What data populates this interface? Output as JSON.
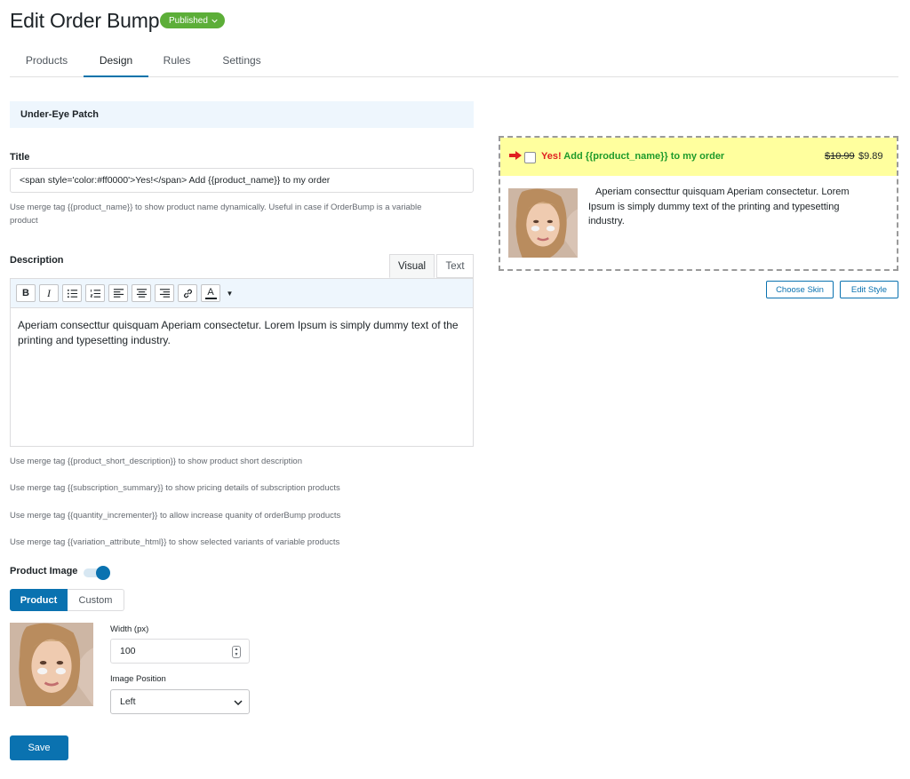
{
  "header": {
    "title": "Edit Order Bump",
    "status": "Published"
  },
  "tabs": [
    {
      "label": "Products"
    },
    {
      "label": "Design"
    },
    {
      "label": "Rules"
    },
    {
      "label": "Settings"
    }
  ],
  "product": {
    "name": "Under-Eye Patch"
  },
  "title_field": {
    "label": "Title",
    "value": "<span style='color:#ff0000'>Yes!</span> Add {{product_name}} to my order",
    "help_line1": "Use merge tag {{product_name}} to show product name dynamically. Useful in case if OrderBump is a variable",
    "help_line2": "product"
  },
  "description": {
    "label": "Description",
    "tab_visual": "Visual",
    "tab_text": "Text",
    "bold": "B",
    "italic": "I",
    "text_color": "A",
    "content": "Aperiam consecttur quisquam Aperiam consectetur. Lorem Ipsum is simply dummy text of the printing and typesetting industry.",
    "help": [
      "Use merge tag {{product_short_description}} to show product short description",
      "Use merge tag {{subscription_summary}} to show pricing details of subscription products",
      "Use merge tag {{quantity_incrementer}} to allow increase quanity of orderBump products",
      "Use merge tag {{variation_attribute_html}} to show selected variants of variable products"
    ]
  },
  "product_image": {
    "label": "Product Image",
    "enabled": true,
    "source_product": "Product",
    "source_custom": "Custom",
    "width_label": "Width (px)",
    "width_value": "100",
    "position_label": "Image Position",
    "position_value": "Left"
  },
  "actions": {
    "save": "Save",
    "choose_skin": "Choose Skin",
    "edit_style": "Edit Style"
  },
  "preview": {
    "yes": "Yes!",
    "title_rest": "Add {{product_name}} to my order",
    "price_old": "$10.99",
    "price_new": "$9.89",
    "description": "Aperiam consecttur quisquam Aperiam consectetur. Lorem Ipsum is simply dummy text of the printing and typesetting industry."
  },
  "colors": {
    "primary": "#0a72b0",
    "published": "#5cae38",
    "highlight": "#ffff9e",
    "yes_text": "#e02020",
    "title_text": "#1e9b2b"
  }
}
